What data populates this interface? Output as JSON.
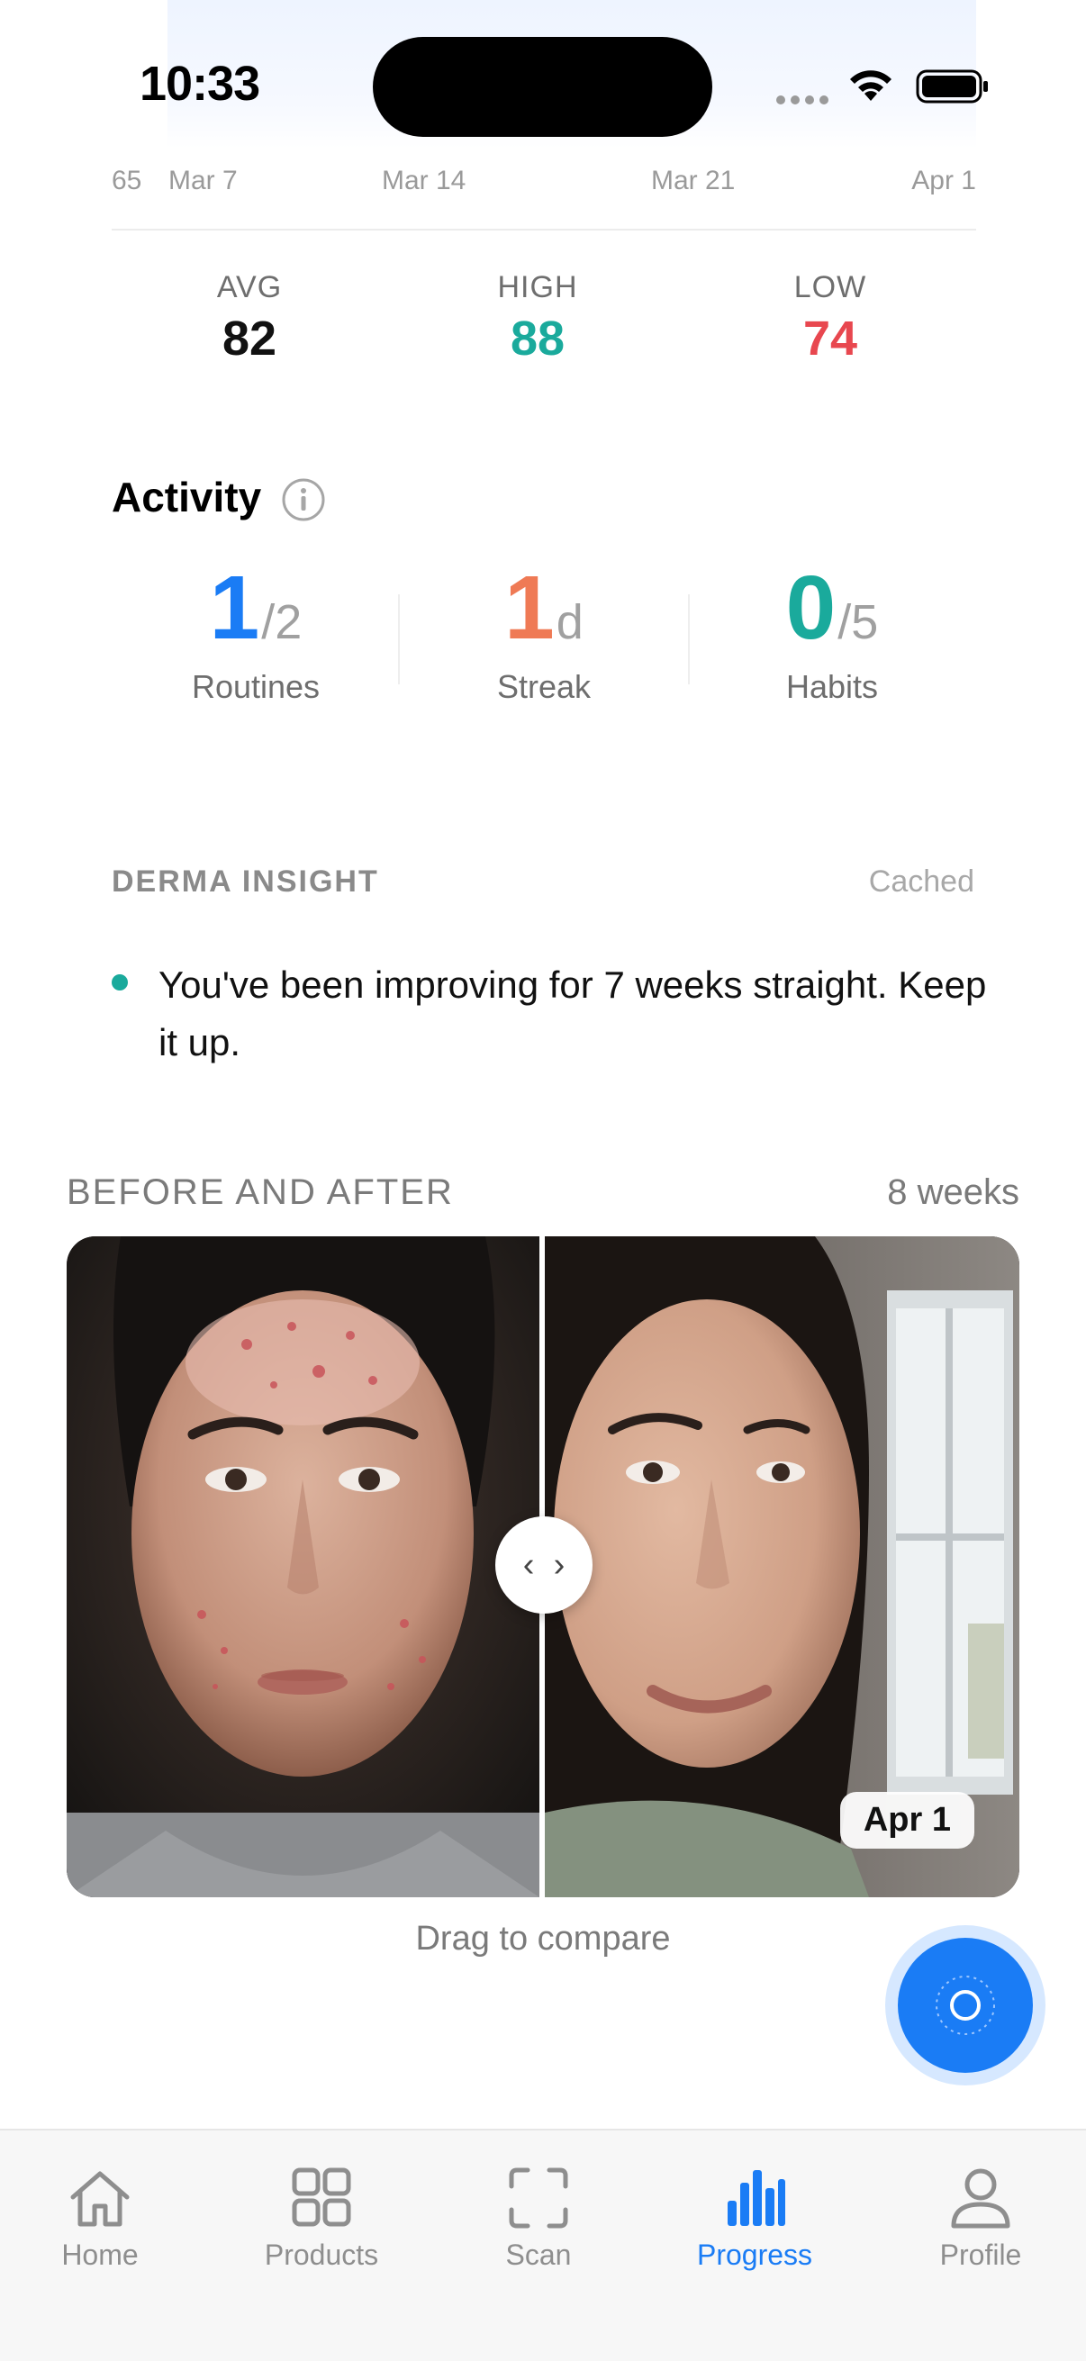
{
  "status_bar": {
    "time": "10:33"
  },
  "chart_axis": {
    "y_tick": "65",
    "x_ticks": [
      "Mar 7",
      "Mar 14",
      "Mar 21",
      "Apr 1"
    ]
  },
  "stats": [
    {
      "label": "AVG",
      "value": "82",
      "color": "#111111"
    },
    {
      "label": "HIGH",
      "value": "88",
      "color": "#1aaa9c"
    },
    {
      "label": "LOW",
      "value": "74",
      "color": "#e8474f"
    }
  ],
  "activity": {
    "title": "Activity",
    "metrics": [
      {
        "value": "1",
        "suffix": "/2",
        "label": "Routines",
        "color": "#1a7cf5"
      },
      {
        "value": "1",
        "suffix": "d",
        "label": "Streak",
        "color": "#ef7a55"
      },
      {
        "value": "0",
        "suffix": "/5",
        "label": "Habits",
        "color": "#1aaa9c"
      }
    ]
  },
  "insight": {
    "heading": "DERMA INSIGHT",
    "status": "Cached",
    "text": "You've been improving for 7 weeks straight. Keep it up."
  },
  "before_after": {
    "heading": "BEFORE AND AFTER",
    "duration": "8 weeks",
    "after_date": "Apr 1",
    "hint": "Drag to compare"
  },
  "tab_bar": {
    "items": [
      {
        "label": "Home",
        "icon": "home-icon",
        "active": false
      },
      {
        "label": "Products",
        "icon": "grid-icon",
        "active": false
      },
      {
        "label": "Scan",
        "icon": "scan-icon",
        "active": false
      },
      {
        "label": "Progress",
        "icon": "bar-chart-icon",
        "active": true
      },
      {
        "label": "Profile",
        "icon": "person-icon",
        "active": false
      }
    ],
    "accent": "#1a7cf5"
  }
}
